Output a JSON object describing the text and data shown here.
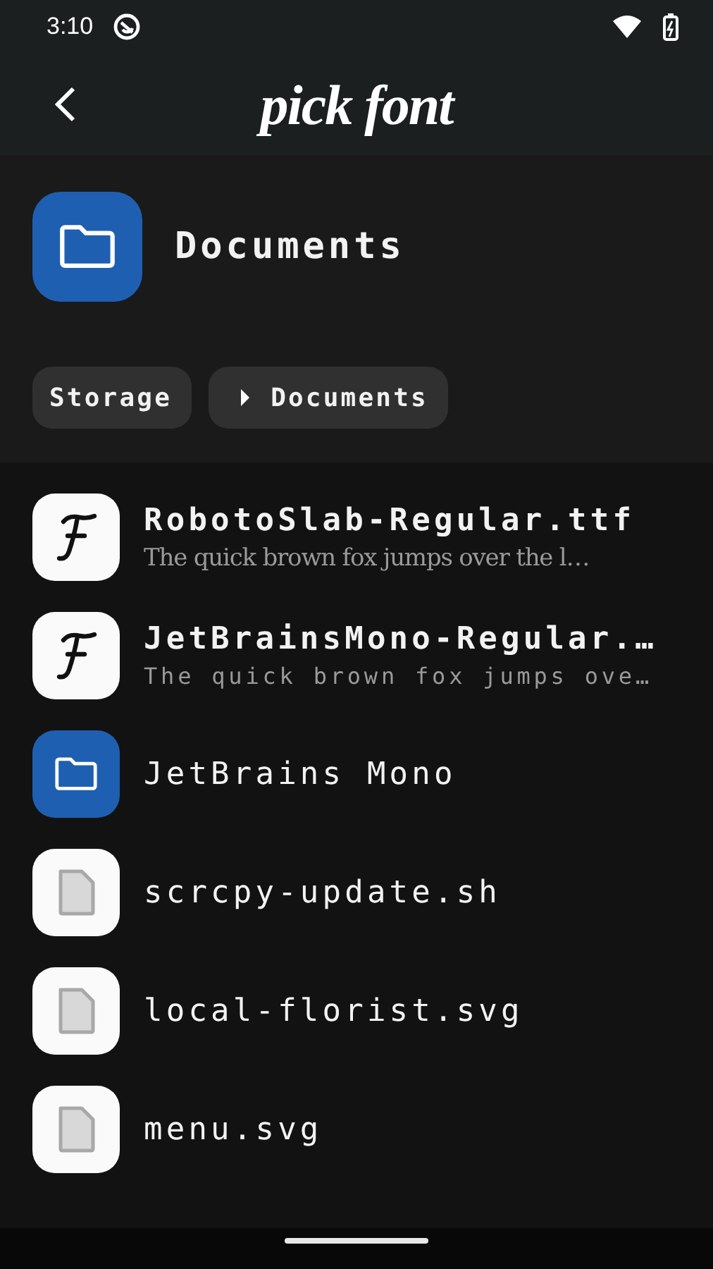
{
  "status_bar": {
    "time": "3:10"
  },
  "app_bar": {
    "title": "pick font"
  },
  "header": {
    "title": "Documents"
  },
  "breadcrumbs": [
    {
      "label": "Storage",
      "separator": false
    },
    {
      "label": "Documents",
      "separator": true
    }
  ],
  "items": [
    {
      "kind": "serif",
      "name": "RobotoSlab-Regular.ttf",
      "preview": "The quick brown fox jumps over the l…"
    },
    {
      "kind": "mono",
      "name": "JetBrainsMono-Regular.…",
      "preview": "The quick brown fox jumps ove…"
    },
    {
      "kind": "folder",
      "name": "JetBrains Mono"
    },
    {
      "kind": "file",
      "name": "scrcpy-update.sh"
    },
    {
      "kind": "file",
      "name": "local-florist.svg"
    },
    {
      "kind": "file",
      "name": "menu.svg"
    }
  ]
}
